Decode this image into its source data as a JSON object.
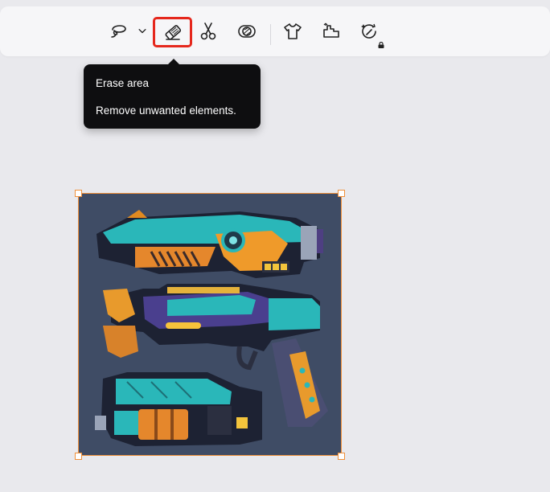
{
  "toolbar": {
    "tools": [
      {
        "name": "lasso-icon"
      },
      {
        "name": "chevron-down-icon"
      },
      {
        "name": "eraser-icon",
        "selected": true
      },
      {
        "name": "scissors-icon"
      },
      {
        "name": "background-remove-icon"
      },
      {
        "name": "tshirt-icon"
      },
      {
        "name": "expand-icon"
      },
      {
        "name": "magic-restore-icon",
        "locked": true
      }
    ],
    "accent_color": "#e5271c"
  },
  "tooltip": {
    "title": "Erase area",
    "description": "Remove unwanted elements."
  },
  "canvas": {
    "image_subject": "three pixel-art sci-fi blaster guns",
    "selection_color": "#f0903a",
    "image_background": "#3f4c65"
  }
}
